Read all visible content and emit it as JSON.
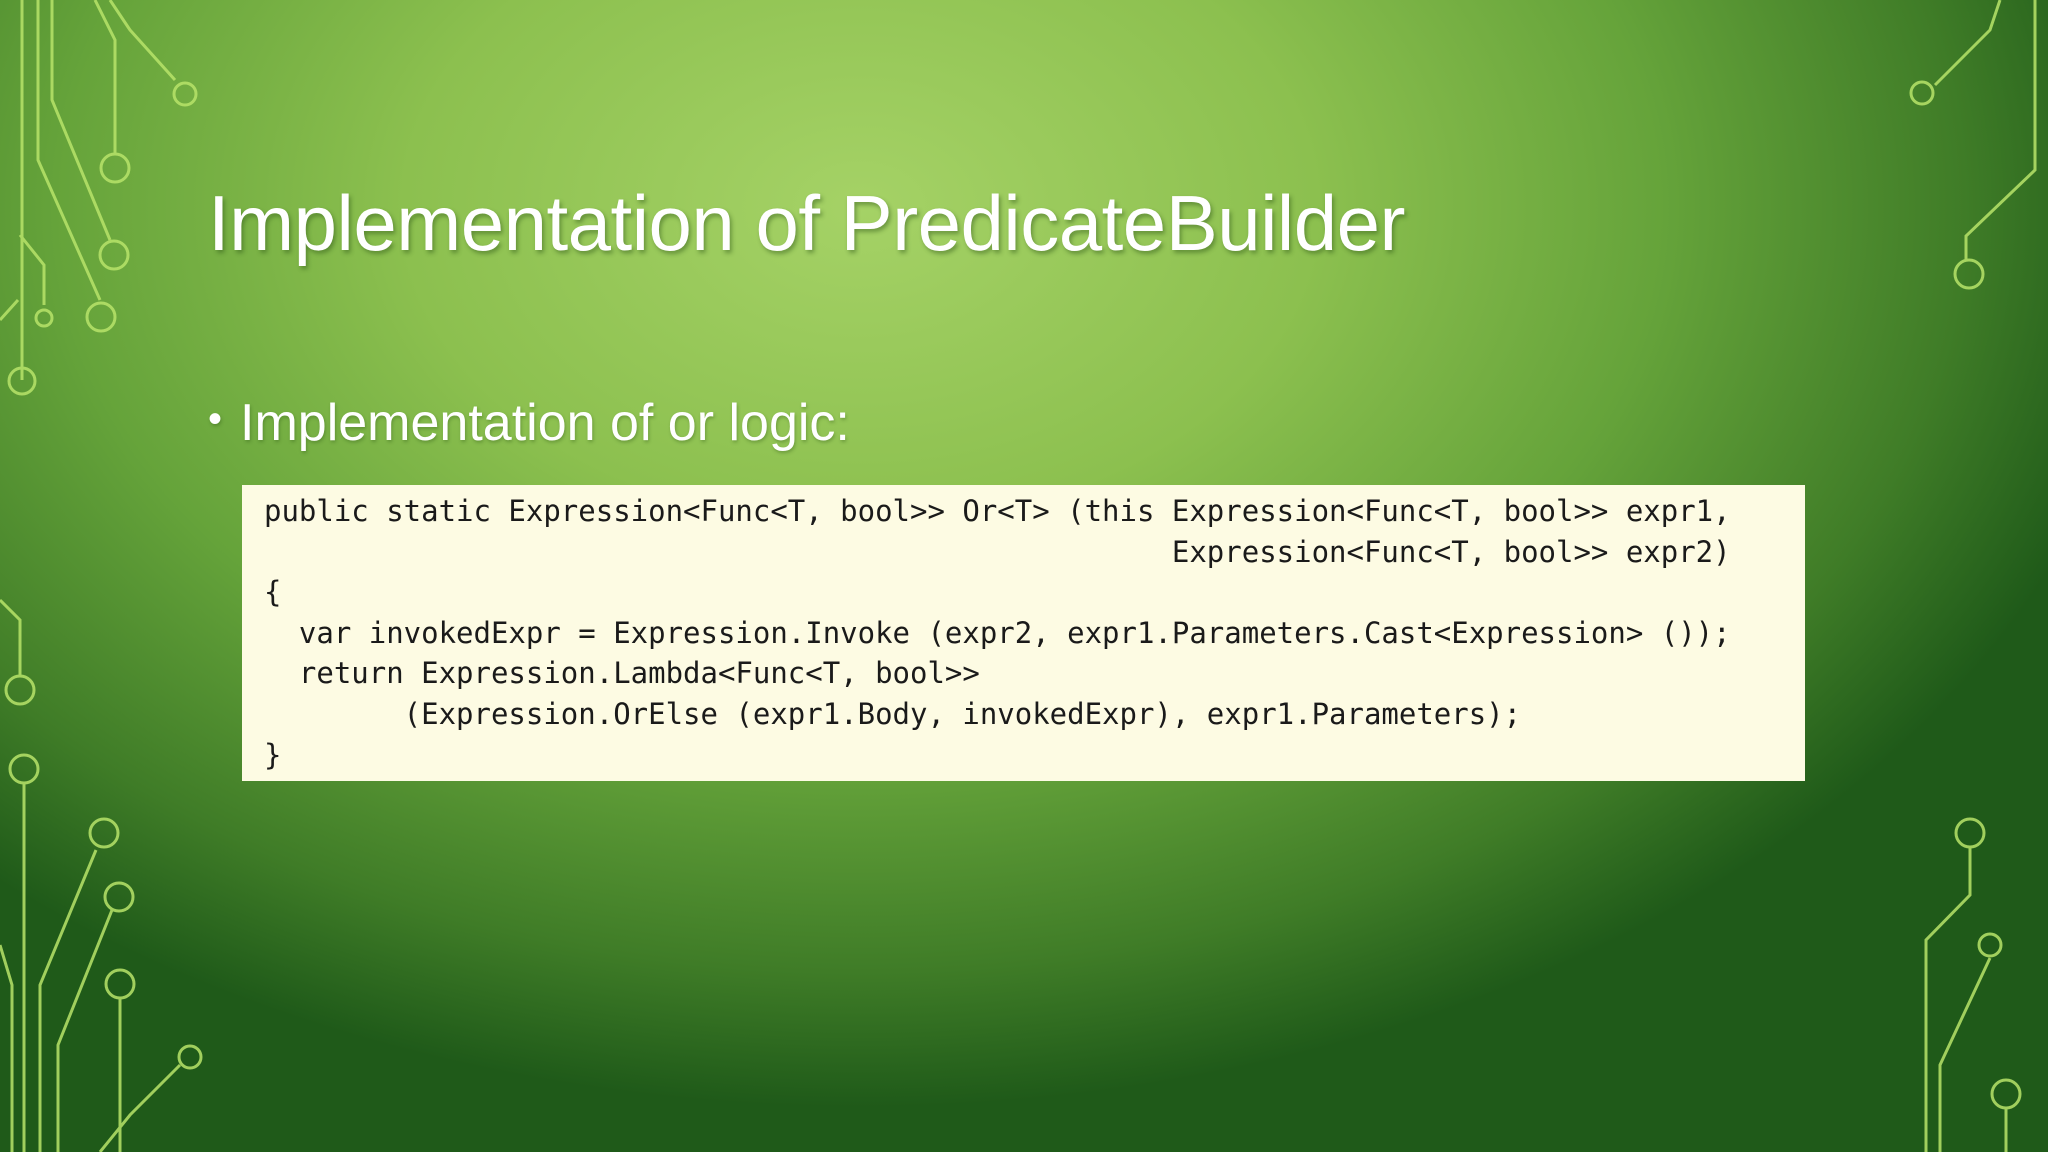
{
  "slide": {
    "title": "Implementation of PredicateBuilder",
    "bullet": "Implementation of or logic:",
    "code_lines": [
      "public static Expression<Func<T, bool>> Or<T> (this Expression<Func<T, bool>> expr1,",
      "                                                    Expression<Func<T, bool>> expr2)",
      "{",
      "  var invokedExpr = Expression.Invoke (expr2, expr1.Parameters.Cast<Expression> ());",
      "  return Expression.Lambda<Func<T, bool>>",
      "        (Expression.OrElse (expr1.Body, invokedExpr), expr1.Parameters);",
      "}"
    ]
  },
  "colors": {
    "background_light": "#a5d266",
    "background_dark": "#1f5a19",
    "circuit_line": "#b8e46a",
    "code_background": "#fdfbe3",
    "title_text": "#ffffff"
  }
}
